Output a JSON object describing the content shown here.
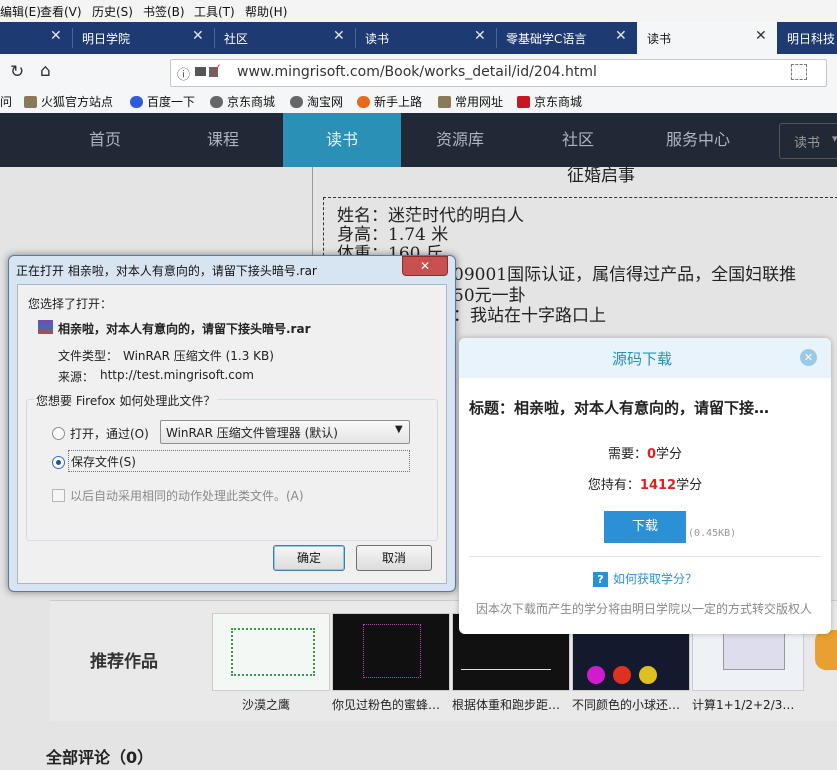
{
  "menu": [
    "编辑(E)",
    "查看(V)",
    "历史(S)",
    "书签(B)",
    "工具(T)",
    "帮助(H)"
  ],
  "tabs": [
    {
      "label": ""
    },
    {
      "label": "明日学院"
    },
    {
      "label": "社区"
    },
    {
      "label": "读书"
    },
    {
      "label": "零基础学C语言"
    },
    {
      "label": "读书"
    },
    {
      "label": "明日科技"
    }
  ],
  "tab_close": "✕",
  "url": "www.mingrisoft.com/Book/works_detail/id/204.html",
  "bookmarks": [
    "问",
    "火狐官方站点",
    "百度一下",
    "京东商城",
    "淘宝网",
    "新手上路",
    "常用网址",
    "京东商城"
  ],
  "site_nav": [
    "首页",
    "课程",
    "读书",
    "资源库",
    "社区",
    "服务中心"
  ],
  "site_search": "读书",
  "article": {
    "heading": "征婚启事",
    "lines": [
      "姓名：迷茫时代的明白人",
      "身高：1.74 米",
      "体重：160 斤",
      "09001国际认证，属信得过产品，全国妇联推",
      "50元一卦",
      "：我站在十字路口上"
    ]
  },
  "dialog": {
    "title": "正在打开 相亲啦，对本人有意向的，请留下接头暗号.rar",
    "chosen": "您选择了打开：",
    "filename": "相亲啦，对本人有意向的，请留下接头暗号.rar",
    "type_label": "文件类型：",
    "type_value": "WinRAR 压缩文件 (1.3 KB)",
    "source_label": "来源：",
    "source_value": "http://test.mingrisoft.com",
    "question": "您想要 Firefox 如何处理此文件？",
    "open_with": "打开，通过(O)",
    "app": "WinRAR 压缩文件管理器 (默认)",
    "save_file": "保存文件(S)",
    "auto": "以后自动采用相同的动作处理此类文件。(A)",
    "ok": "确定",
    "cancel": "取消"
  },
  "popup": {
    "title": "源码下载",
    "subject": "标题：相亲啦，对本人有意向的，请留下接…",
    "need_label": "需要：",
    "need_value": "0",
    "have_label": "您持有：",
    "have_value": "1412",
    "unit": "学分",
    "download": "下载",
    "size": "(0.45KB)",
    "how": "如何获取学分？",
    "note": "因本次下载而产生的学分将由明日学院以一定的方式转交版权人"
  },
  "recommend": {
    "title": "推荐作品",
    "items": [
      "沙漠之鹰",
      "你见过粉色的蜜蜂…",
      "根据体重和跑步距…",
      "不同颜色的小球还…",
      "计算1+1/2+2/3…"
    ]
  },
  "comments": "全部评论（0）",
  "colors": {
    "tabbar": "#1e3a73",
    "accent": "#2b90b6",
    "red": "#e0201b"
  }
}
